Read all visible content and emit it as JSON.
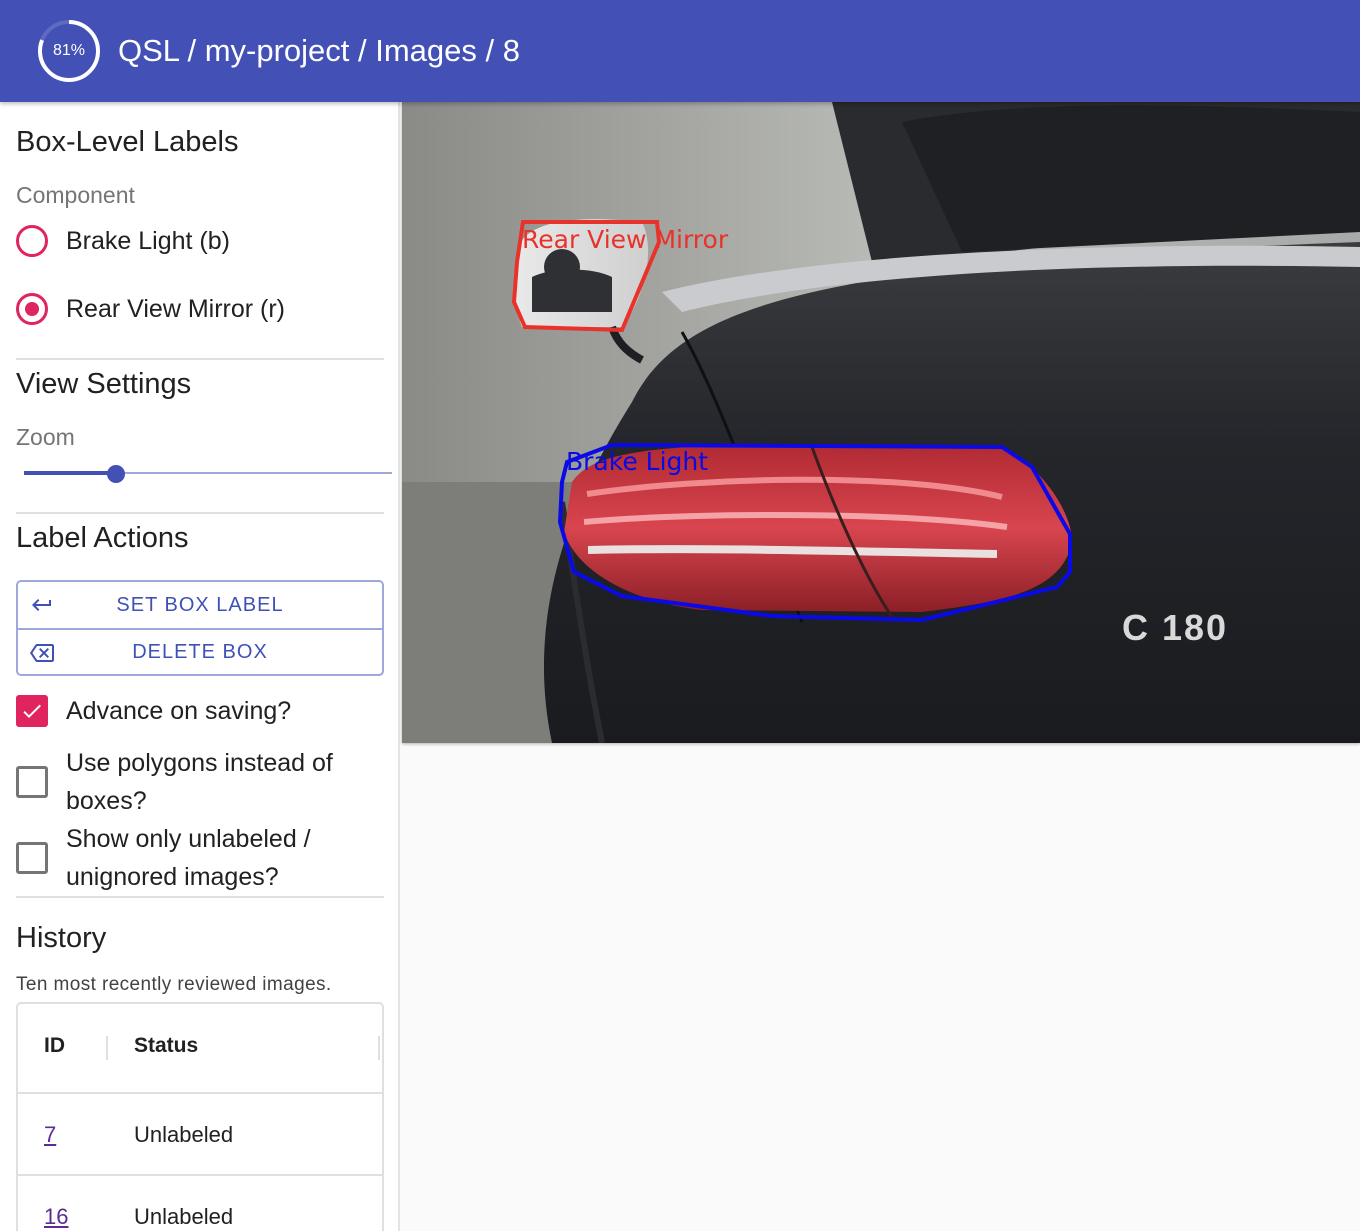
{
  "app": {
    "progress_text": "81%",
    "progress_percent": 81,
    "title": "QSL / my-project / Images / 8",
    "accent_color": "#4350b5"
  },
  "sidebar": {
    "box_labels": {
      "heading": "Box-Level Labels",
      "group_caption": "Component",
      "options": [
        {
          "label": "Brake Light (b)",
          "checked": false
        },
        {
          "label": "Rear View Mirror (r)",
          "checked": true
        }
      ]
    },
    "view_settings": {
      "heading": "View Settings",
      "zoom_caption": "Zoom",
      "zoom_fraction": 0.25
    },
    "label_actions": {
      "heading": "Label Actions",
      "set_box_label": "SET BOX LABEL",
      "delete_box": "DELETE BOX",
      "set_icon": "enter-arrow-icon",
      "delete_icon": "backspace-icon"
    },
    "options": {
      "advance_on_saving": {
        "label": "Advance on saving?",
        "checked": true
      },
      "use_polygons": {
        "label": "Use polygons instead of boxes?",
        "checked": false
      },
      "show_unlabeled": {
        "label": "Show only unlabeled / unignored images?",
        "checked": false
      }
    },
    "history": {
      "heading": "History",
      "subtitle": "Ten most recently reviewed images.",
      "columns": [
        "ID",
        "Status"
      ],
      "rows": [
        {
          "id": "7",
          "status": "Unlabeled"
        },
        {
          "id": "16",
          "status": "Unlabeled"
        }
      ]
    }
  },
  "canvas": {
    "annotations": [
      {
        "label": "Rear View Mirror",
        "color": "#e8322a"
      },
      {
        "label": "Brake Light",
        "color": "#0a0ae6"
      }
    ],
    "badge_text": "C 180"
  }
}
